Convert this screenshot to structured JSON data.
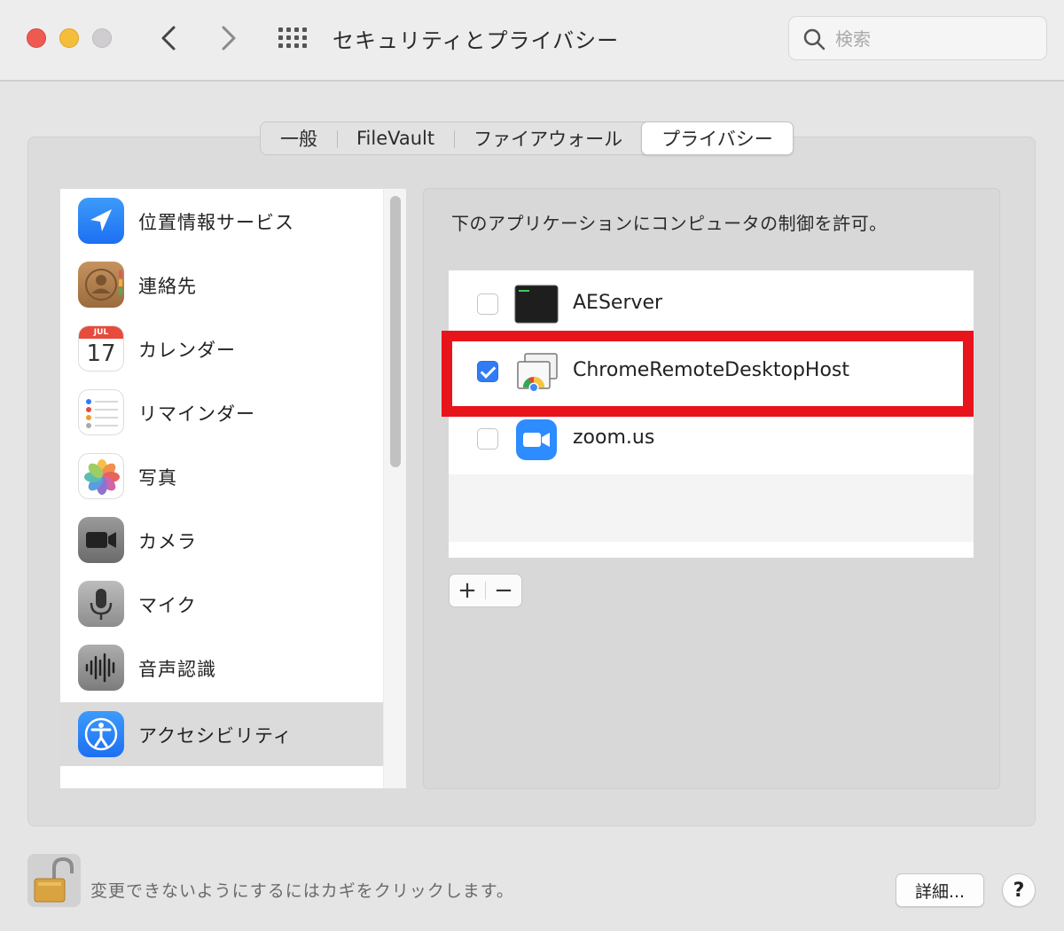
{
  "window": {
    "title": "セキュリティとプライバシー",
    "search_placeholder": "検索"
  },
  "tabs": [
    {
      "label": "一般",
      "active": false
    },
    {
      "label": "FileVault",
      "active": false
    },
    {
      "label": "ファイアウォール",
      "active": false
    },
    {
      "label": "プライバシー",
      "active": true
    }
  ],
  "sidebar": {
    "items": [
      {
        "label": "位置情報サービス",
        "icon": "location-arrow-icon",
        "selected": false
      },
      {
        "label": "連絡先",
        "icon": "contacts-icon",
        "selected": false
      },
      {
        "label": "カレンダー",
        "icon": "calendar-icon",
        "selected": false,
        "icon_month": "JUL",
        "icon_day": "17"
      },
      {
        "label": "リマインダー",
        "icon": "reminders-icon",
        "selected": false
      },
      {
        "label": "写真",
        "icon": "photos-icon",
        "selected": false
      },
      {
        "label": "カメラ",
        "icon": "camera-icon",
        "selected": false
      },
      {
        "label": "マイク",
        "icon": "microphone-icon",
        "selected": false
      },
      {
        "label": "音声認識",
        "icon": "speech-recognition-icon",
        "selected": false
      },
      {
        "label": "アクセシビリティ",
        "icon": "accessibility-icon",
        "selected": true
      }
    ]
  },
  "pane": {
    "description": "下のアプリケーションにコンピュータの制御を許可。",
    "apps": [
      {
        "name": "AEServer",
        "checked": false,
        "icon": "terminal-icon"
      },
      {
        "name": "ChromeRemoteDesktopHost",
        "checked": true,
        "icon": "chrome-remote-desktop-icon"
      },
      {
        "name": "zoom.us",
        "checked": false,
        "icon": "zoom-icon"
      }
    ],
    "add_label": "+",
    "remove_label": "−"
  },
  "footer": {
    "lock_text": "変更できないようにするにはカギをクリックします。",
    "detail_label": "詳細...",
    "help_label": "?"
  },
  "colors": {
    "accent_blue": "#2f7cf6",
    "highlight_red": "#e8141c",
    "selected_row": "#dcdbdc"
  }
}
